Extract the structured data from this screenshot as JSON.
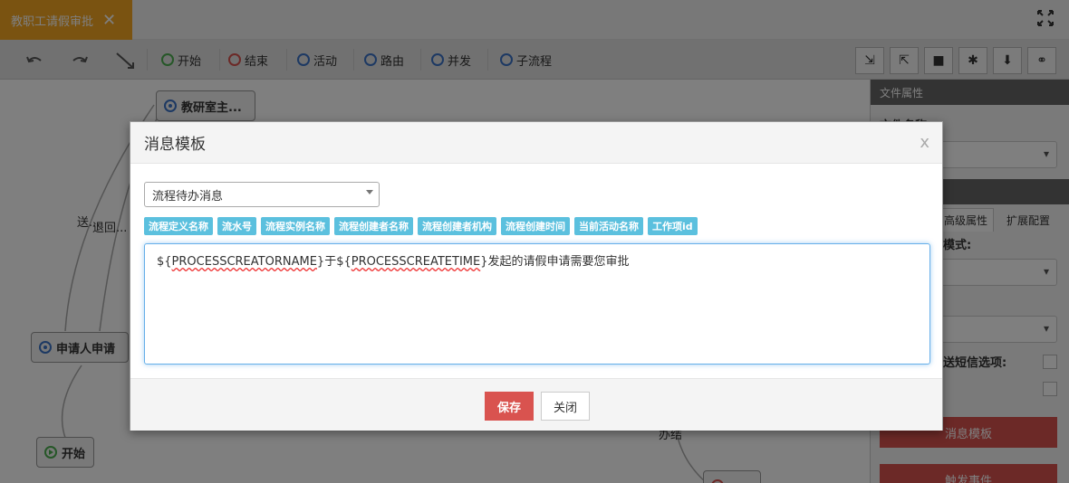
{
  "tab": {
    "title": "教职工请假审批",
    "close": "✕"
  },
  "toolbar": {
    "start": "开始",
    "end": "结束",
    "activity": "活动",
    "route": "路由",
    "parallel": "并发",
    "subflow": "子流程"
  },
  "canvas": {
    "nodes": {
      "teacher": "教研室主...",
      "applicant": "申请人申请",
      "start": "开始"
    },
    "labels": {
      "send": "送",
      "send2": "送...",
      "back": "退回...",
      "done": "办结"
    }
  },
  "panel": {
    "file_props": "文件属性",
    "file_name": "文件名称:",
    "tab_advanced": "高级属性",
    "tab_extend": "扩展配置",
    "mode": "模式:",
    "sms": "送短信选项:",
    "message_template": "消息模板",
    "trigger_event": "触发事件"
  },
  "modal": {
    "title": "消息模板",
    "close": "x",
    "select_value": "流程待办消息",
    "chips": [
      "流程定义名称",
      "流水号",
      "流程实例名称",
      "流程创建者名称",
      "流程创建者机构",
      "流程创建时间",
      "当前活动名称",
      "工作项id"
    ],
    "text_parts": [
      "${",
      "PROCESSCREATORNAME",
      "}于${",
      "PROCESSCREATETIME",
      "}发起的请假申请需要您审批"
    ],
    "save": "保存",
    "cancel": "关闭"
  },
  "colors": {
    "tab": "#f5a623",
    "chip": "#5bc0de",
    "save": "#d9534f"
  }
}
